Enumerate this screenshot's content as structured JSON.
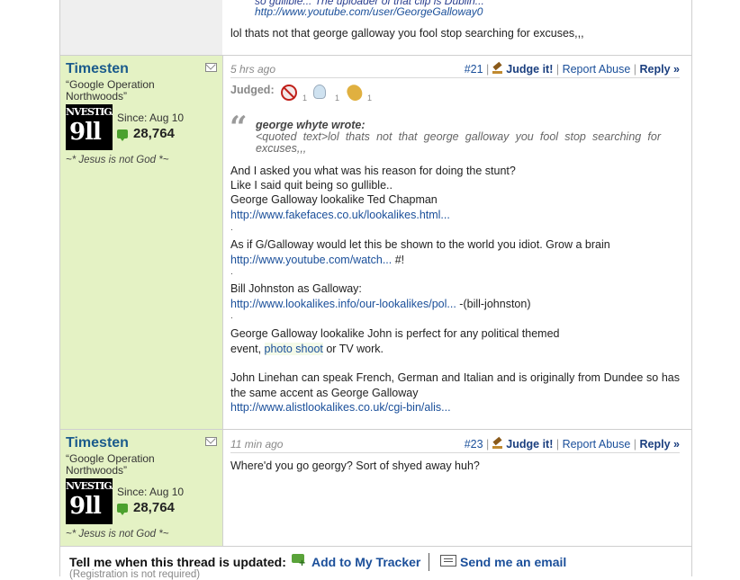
{
  "top_post": {
    "partial_line": "so gullible... The uploader of that clip is Dublin...",
    "link": "http://www.youtube.com/user/GeorgeGalloway0",
    "body": "lol thats not that george galloway you fool stop searching for excuses,,,"
  },
  "post1": {
    "username": "Timesten",
    "user_title": "“Google Operation Northwoods”",
    "avatar_top": "NVESTIGAT",
    "avatar_big": "9ll",
    "since": "Since: Aug 10",
    "points": "28,764",
    "signature": "~* Jesus is not God *~",
    "time": "5 hrs ago",
    "number": "#21",
    "judge": "Judge it!",
    "report": "Report Abuse",
    "reply": "Reply »",
    "judged_label": "Judged:",
    "judged_counts": [
      "1",
      "1",
      "1"
    ],
    "quote_author": "george whyte wrote:",
    "quote_text": "<quoted text>lol thats not that george galloway you fool stop searching for excuses,,,",
    "lines": {
      "l1": "And I asked you what was his reason for doing the stunt?",
      "l2": "Like I said quit being so gullible..",
      "l3": "George Galloway lookalike Ted Chapman",
      "link1": "http://www.fakefaces.co.uk/lookalikes.html...",
      "dot1": ".",
      "l4": "As if G/Galloway would let this be shown to the world you idiot. Grow a brain",
      "link2": "http://www.youtube.com/watch...",
      "link2_after": " #!",
      "dot2": ".",
      "l5": "Bill Johnston as Galloway:",
      "link3": "http://www.lookalikes.info/our-lookalikes/pol...",
      "link3_after": " -(bill-johnston)",
      "dot3": ".",
      "l6": "George Galloway lookalike John is perfect for any political themed",
      "l7_before": "event, ",
      "l7_link": "photo shoot",
      "l7_after": " or TV work.",
      "l8": "John Linehan can speak French, German and Italian and is originally from Dundee so has the same accent as George Galloway",
      "link4": "http://www.alistlookalikes.co.uk/cgi-bin/alis..."
    }
  },
  "post2": {
    "username": "Timesten",
    "user_title": "“Google Operation Northwoods”",
    "avatar_top": "NVESTIGAT",
    "avatar_big": "9ll",
    "since": "Since: Aug 10",
    "points": "28,764",
    "signature": "~* Jesus is not God *~",
    "time": "11 min ago",
    "number": "#23",
    "judge": "Judge it!",
    "report": "Report Abuse",
    "reply": "Reply »",
    "body": "Where'd you go georgy? Sort of shyed away huh?"
  },
  "footer": {
    "tell": "Tell me when this thread is updated:",
    "tracker": "Add to My Tracker",
    "email": "Send me an email",
    "registration": "(Registration is not required)"
  }
}
